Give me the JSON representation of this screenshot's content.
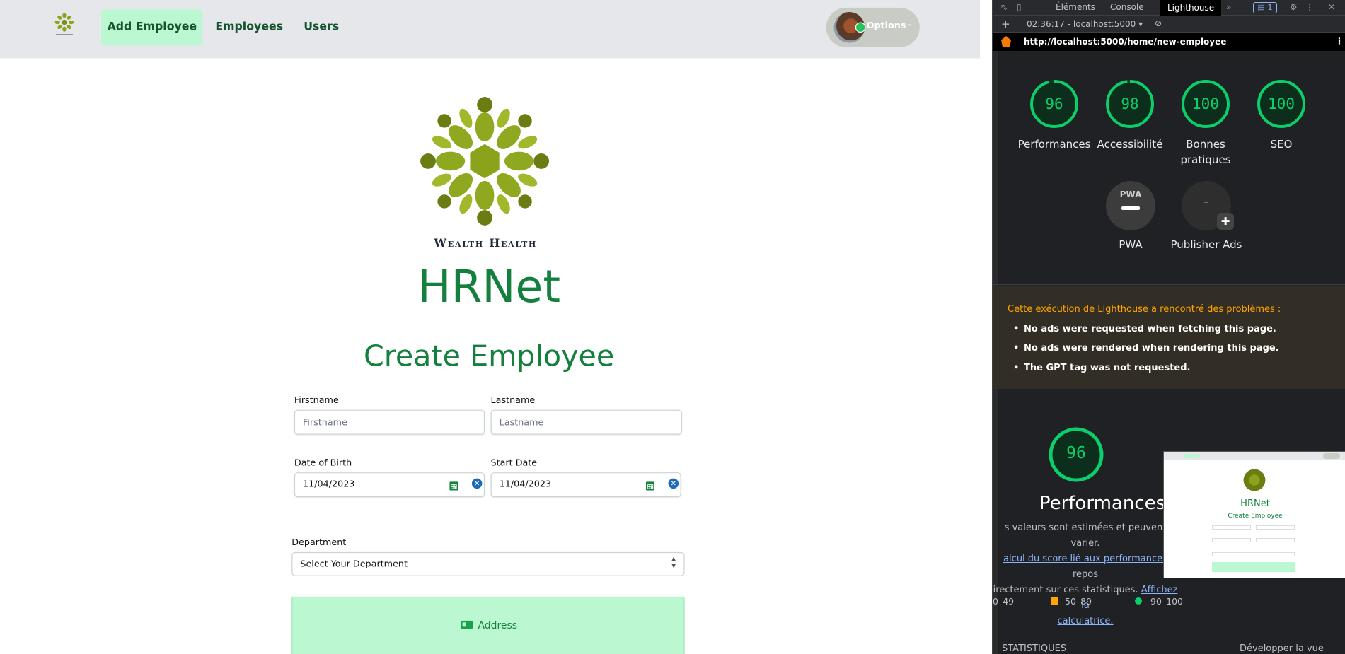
{
  "nav": {
    "links": [
      "Add Employee",
      "Employees",
      "Users"
    ],
    "options_label": "Options"
  },
  "hero": {
    "brand": "Wealth Health",
    "app_name": "HRNet",
    "page_title": "Create Employee"
  },
  "form": {
    "firstname": {
      "label": "Firstname",
      "placeholder": "Firstname",
      "value": ""
    },
    "lastname": {
      "label": "Lastname",
      "placeholder": "Lastname",
      "value": ""
    },
    "dob": {
      "label": "Date of Birth",
      "value": "11/04/2023"
    },
    "start": {
      "label": "Start Date",
      "value": "11/04/2023"
    },
    "department": {
      "label": "Department",
      "selected": "Select Your Department"
    },
    "address_label": "Address"
  },
  "devtools": {
    "tabs": [
      "Éléments",
      "Console",
      "Lighthouse"
    ],
    "active_tab": "Lighthouse",
    "issues_count": "1",
    "session": "02:36:17 - localhost:5000",
    "url": "http://localhost:5000/home/new-employee",
    "scores": [
      {
        "value": 96,
        "label": "Performances"
      },
      {
        "value": 98,
        "label": "Accessibilité"
      },
      {
        "value": 100,
        "label": "Bonnes pratiques"
      },
      {
        "value": 100,
        "label": "SEO"
      }
    ],
    "pwa_label": "PWA",
    "pwa_badge": "PWA",
    "publisher_label": "Publisher Ads",
    "publisher_value": "–",
    "warning_title": "Cette exécution de Lighthouse a rencontré des problèmes :",
    "warnings": [
      "No ads were requested when fetching this page.",
      "No ads were rendered when rendering this page.",
      "The GPT tag was not requested."
    ],
    "perf_score": 96,
    "perf_title": "Performances",
    "perf_desc_1": "s valeurs sont estimées et peuvent varier.",
    "perf_link_1": "alcul du score lié aux performances",
    "perf_desc_2": "repos",
    "perf_desc_3": "irectement sur ces statistiques.",
    "perf_link_2": "Affichez la",
    "perf_link_3": "calculatrice.",
    "legend": [
      "0–49",
      "50–89",
      "90–100"
    ],
    "stats_label": "STATISTIQUES",
    "expand_label": "Développer la vue",
    "thumb": {
      "app_name": "HRNet",
      "page_title": "Create Employee"
    }
  },
  "colors": {
    "accent_green": "#15803d",
    "nav_active_bg": "#bbf7d0",
    "lighthouse_pass": "#0cce6b",
    "lighthouse_average": "#ffa400"
  }
}
